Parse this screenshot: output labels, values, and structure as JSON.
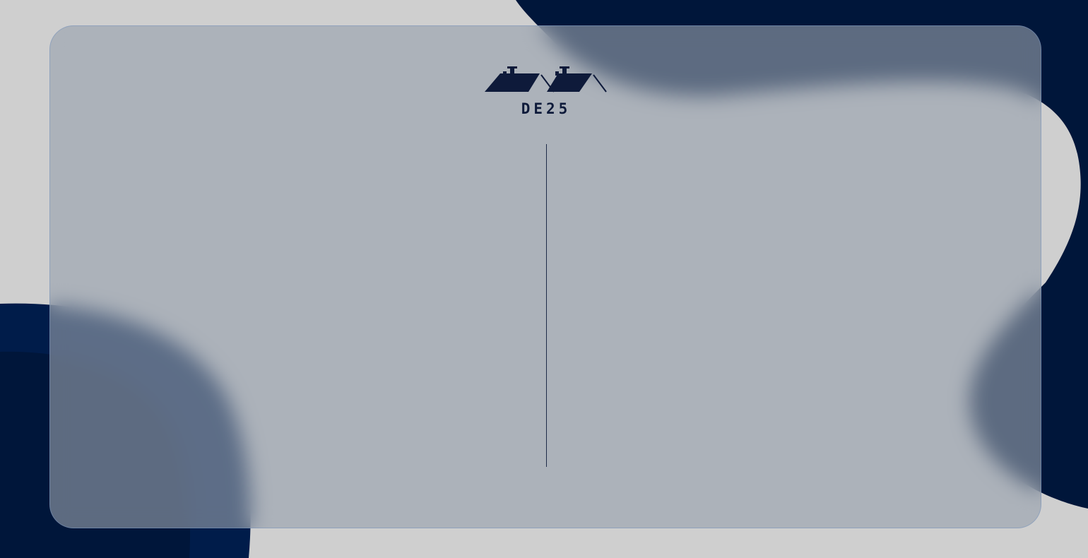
{
  "brand": {
    "name": "DE25",
    "logo_icon": "two-house-roofs-icon"
  },
  "colors": {
    "navy": "#00163a",
    "navy_light": "#001c4a",
    "page_bg": "#cfcfcf",
    "card_tint": "#99a0aa"
  }
}
